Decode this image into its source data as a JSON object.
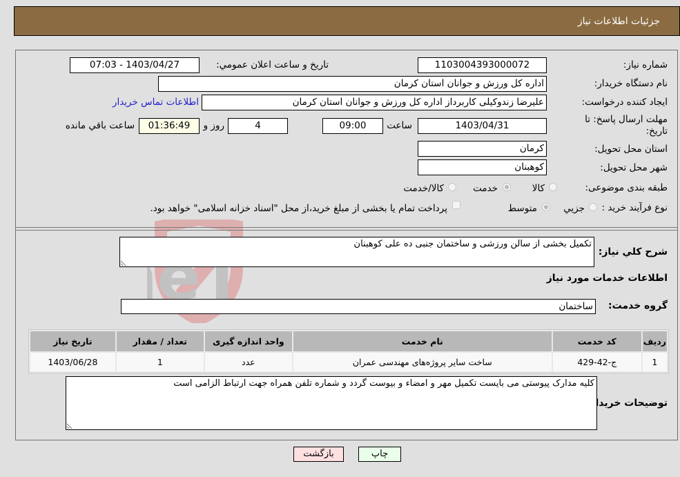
{
  "header": {
    "title": "جزئیات اطلاعات نیاز"
  },
  "form": {
    "need_number": {
      "label": "شماره نیاز:",
      "value": "1103004393000072"
    },
    "announce_datetime": {
      "label": "تاریخ و ساعت اعلان عمومي:",
      "value": "1403/04/27 - 07:03"
    },
    "buyer_org": {
      "label": "نام دستگاه خریدار:",
      "value": "اداره کل ورزش و جوانان استان کرمان"
    },
    "requester": {
      "label": "ایجاد کننده درخواست:",
      "value": "علیرضا  زندوکیلی  کاربرداز اداره کل ورزش و جوانان استان کرمان"
    },
    "buyer_contact_link": "اطلاعات تماس خریدار",
    "deadline": {
      "label": "مهلت ارسال پاسخ: تا تاریخ:",
      "date": "1403/04/31",
      "time_label": "ساعت",
      "time": "09:00",
      "days": "4",
      "days_label": "روز و",
      "remaining": "01:36:49",
      "remaining_label": "ساعت باقي مانده"
    },
    "delivery_province": {
      "label": "استان محل تحویل:",
      "value": "کرمان"
    },
    "delivery_city": {
      "label": "شهر محل تحویل:",
      "value": "کوهبنان"
    },
    "category": {
      "label": "طبقه بندی موضوعی:",
      "options": [
        "کالا",
        "خدمت",
        "کالا/خدمت"
      ],
      "selected": "خدمت"
    },
    "purchase_type": {
      "label": "نوع فرآیند خرید :",
      "options": [
        "جزيي",
        "متوسط"
      ],
      "selected": "متوسط",
      "treasury_note": "پرداخت تمام یا بخشی از مبلغ خرید،از محل \"اسناد خزانه اسلامی\" خواهد بود."
    },
    "description": {
      "label": "شرح کلي نیاز:",
      "value": "تکمیل بخشی از سالن ورزشی و ساختمان جنبی ده علی کوهبنان"
    },
    "services_heading": "اطلاعات خدمات مورد نیاز",
    "service_group": {
      "label": "گروه خدمت:",
      "value": "ساختمان"
    }
  },
  "table": {
    "headers": [
      "ردیف",
      "کد خدمت",
      "نام خدمت",
      "واحد اندازه گیری",
      "تعداد / مقدار",
      "تاریخ نیاز"
    ],
    "rows": [
      [
        "1",
        "ج-42-429",
        "ساخت سایر پروژه‌های مهندسی عمران",
        "عدد",
        "1",
        "1403/06/28"
      ]
    ]
  },
  "buyer_notes": {
    "label": "توضیحات خریدار:",
    "value": "کلیه مدارک پیوستی می بایست تکمیل مهر و امضاء و بیوست گردد و شماره تلفن همراه جهت ارتباط الزامی است"
  },
  "buttons": {
    "print": "چاپ",
    "back": "بازگشت"
  },
  "colors": {
    "header_bg": "#8b6c42",
    "print_bg": "#eaffea",
    "back_bg": "#ffe0e0",
    "link": "#2222cc"
  },
  "watermark": "AriaTender.neT"
}
